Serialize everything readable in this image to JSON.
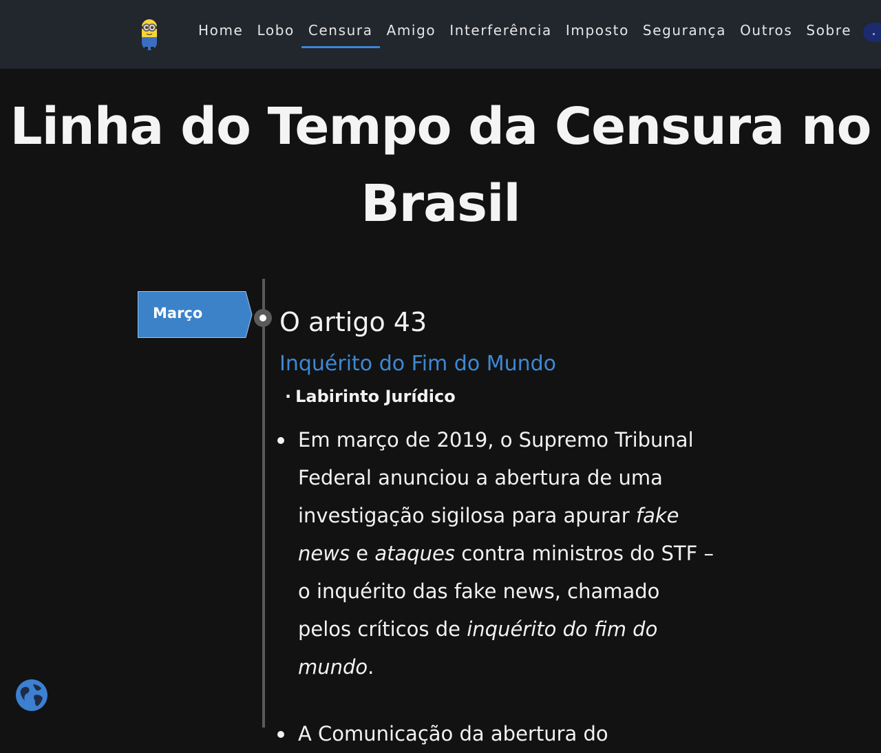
{
  "nav": {
    "links": [
      {
        "label": "Home",
        "active": false
      },
      {
        "label": "Lobo",
        "active": false
      },
      {
        "label": "Censura",
        "active": true
      },
      {
        "label": "Amigo",
        "active": false
      },
      {
        "label": "Interferência",
        "active": false
      },
      {
        "label": "Imposto",
        "active": false
      },
      {
        "label": "Segurança",
        "active": false
      },
      {
        "label": "Outros",
        "active": false
      },
      {
        "label": "Sobre",
        "active": false
      }
    ],
    "logo_icon": "minion-icon",
    "toggle_icon": "theme-toggle-icon"
  },
  "page": {
    "title": "Linha do Tempo da Censura no Brasil"
  },
  "timeline": {
    "entry": {
      "month": "Março",
      "title": "O artigo 43",
      "link": "Inquérito do Fim do Mundo",
      "meta_bullet": "·",
      "meta": "Labirinto Jurídico",
      "paragraph_parts": {
        "p1": "Em março de 2019, o Supremo Tribunal Federal anunciou a abertura de uma investigação sigilosa para apurar ",
        "em1": "fake news",
        "p2": " e ",
        "em2": "ataques",
        "p3": " contra ministros do STF – o inquérito das fake news, chamado pelos críticos de ",
        "em3": "inquérito do fim do mundo",
        "p4": "."
      },
      "next_item_partial": "A Comunicação da abertura do"
    }
  },
  "colors": {
    "background": "#121212",
    "navbar": "#22262d",
    "accent": "#3a86d6",
    "month_tag": "#3c82c9"
  },
  "globe_icon": "globe-icon"
}
